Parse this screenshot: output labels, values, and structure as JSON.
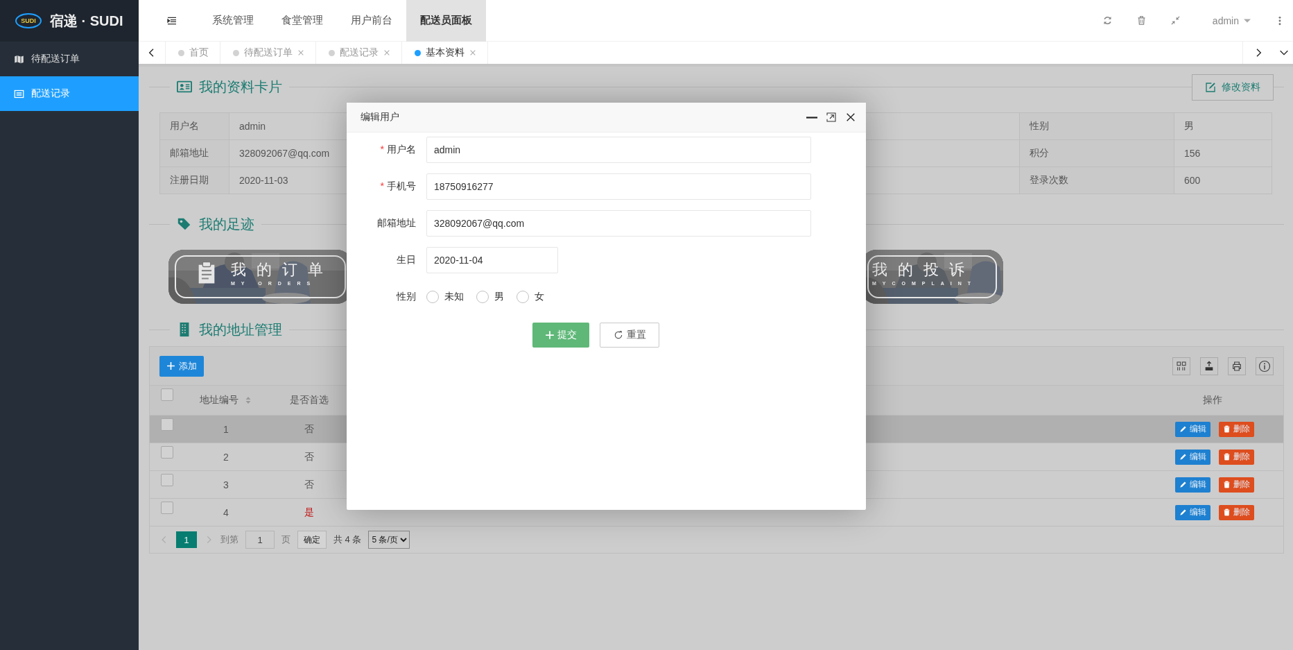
{
  "header": {
    "logo_badge": "SUDI",
    "logo_title": "宿递 · SUDI",
    "nav": [
      {
        "label": "系统管理",
        "selected": false
      },
      {
        "label": "食堂管理",
        "selected": false
      },
      {
        "label": "用户前台",
        "selected": false
      },
      {
        "label": "配送员面板",
        "selected": true
      }
    ],
    "user": "admin"
  },
  "sidebar": {
    "items": [
      {
        "label": "待配送订单",
        "selected": false
      },
      {
        "label": "配送记录",
        "selected": true
      }
    ]
  },
  "tabs": [
    {
      "label": "首页",
      "closable": false,
      "selected": false
    },
    {
      "label": "待配送订单",
      "closable": true,
      "selected": false
    },
    {
      "label": "配送记录",
      "closable": true,
      "selected": false
    },
    {
      "label": "基本资料",
      "closable": true,
      "selected": true
    }
  ],
  "profile": {
    "title": "我的资料卡片",
    "edit_button": "修改资料",
    "rows": [
      {
        "left": {
          "label": "用户名",
          "value": "admin"
        },
        "right": {
          "label": "性别",
          "value": "男"
        }
      },
      {
        "left": {
          "label": "邮箱地址",
          "value": "328092067@qq.com"
        },
        "right": {
          "label": "积分",
          "value": "156"
        }
      },
      {
        "left": {
          "label": "注册日期",
          "value": "2020-11-03"
        },
        "right": {
          "label": "登录次数",
          "value": "600"
        }
      }
    ]
  },
  "footprint": {
    "title": "我的足迹",
    "cards": [
      {
        "kind": "orders",
        "title": "我的订单",
        "subtitle": "MY ORDERS"
      },
      {
        "kind": "complaint",
        "title": "我的投诉",
        "subtitle": "MYCOMPLAINT"
      }
    ]
  },
  "addresses": {
    "title": "我的地址管理",
    "add_button": "添加",
    "header_checked": false,
    "columns": [
      {
        "label": "地址编号",
        "sortable": true
      },
      {
        "label": "是否首选",
        "sortable": false
      },
      {
        "label": "操作",
        "sortable": false
      }
    ],
    "rows": [
      {
        "checked": false,
        "highlighted": true,
        "id": "1",
        "preferred_text": "否",
        "preferred": false,
        "edit": "编辑",
        "delete": "删除"
      },
      {
        "checked": false,
        "highlighted": false,
        "id": "2",
        "preferred_text": "否",
        "preferred": false,
        "edit": "编辑",
        "delete": "删除"
      },
      {
        "checked": false,
        "highlighted": false,
        "id": "3",
        "preferred_text": "否",
        "preferred": false,
        "edit": "编辑",
        "delete": "删除"
      },
      {
        "checked": false,
        "highlighted": false,
        "id": "4",
        "preferred_text": "是",
        "preferred": true,
        "edit": "编辑",
        "delete": "删除"
      }
    ],
    "pagination": {
      "pages": [
        {
          "label": "1",
          "selected": true
        }
      ],
      "goto_label": "到第",
      "goto_value": "1",
      "page_unit": "页",
      "confirm": "确定",
      "total": "共 4 条",
      "page_size": "5 条/页"
    }
  },
  "modal": {
    "title": "编辑用户",
    "fields": [
      {
        "kind": "text",
        "label": "用户名",
        "required_mark": "*",
        "value": "admin"
      },
      {
        "kind": "text",
        "label": "手机号",
        "required_mark": "*",
        "value": "18750916277"
      },
      {
        "kind": "text",
        "label": "邮箱地址",
        "value": "328092067@qq.com"
      },
      {
        "kind": "date",
        "label": "生日",
        "value": "2020-11-04"
      },
      {
        "kind": "radio",
        "label": "性别",
        "options": [
          {
            "label": "未知",
            "selected": false
          },
          {
            "label": "男",
            "selected": false
          },
          {
            "label": "女",
            "selected": false
          }
        ]
      }
    ],
    "buttons": [
      {
        "kind": "submit",
        "label": "提交"
      },
      {
        "kind": "reset",
        "label": "重置"
      }
    ]
  }
}
